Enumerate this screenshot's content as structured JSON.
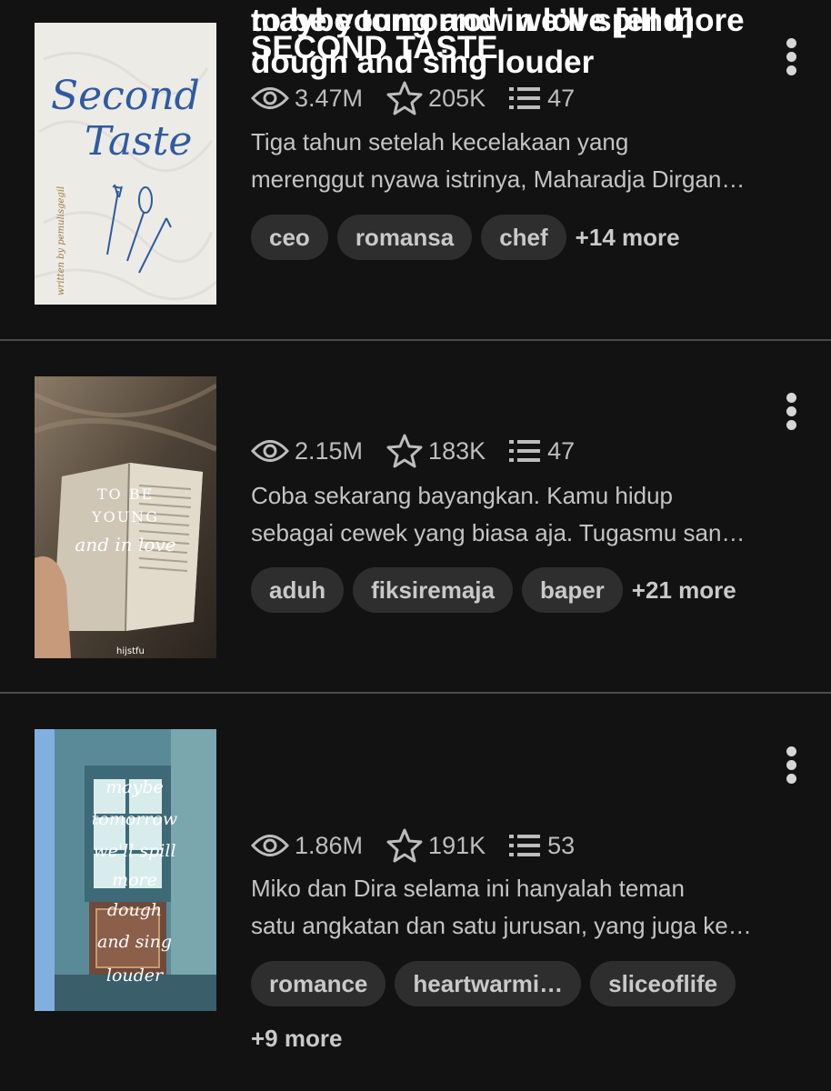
{
  "stories": [
    {
      "title": "SECOND TASTE",
      "views": "3.47M",
      "votes": "205K",
      "parts": "47",
      "desc_line1": "Tiga tahun setelah kecelakaan yang",
      "desc_line2": "merenggut nyawa istrinya, Maharadja Dirgan…",
      "tags": [
        "ceo",
        "romansa",
        "chef"
      ],
      "more": "+14 more",
      "cover_text": [
        "Second",
        "Taste",
        "written by pemulisgegil"
      ]
    },
    {
      "title": "to be young and in love [end]",
      "views": "2.15M",
      "votes": "183K",
      "parts": "47",
      "desc_line1": "Coba sekarang bayangkan. Kamu hidup",
      "desc_line2": "sebagai cewek yang biasa aja. Tugasmu san…",
      "tags": [
        "aduh",
        "fiksiremaja",
        "baper"
      ],
      "more": "+21 more",
      "cover_text": [
        "TO BE",
        "YOUNG",
        "and in love",
        "hijstfu"
      ]
    },
    {
      "title_line1": "maybe tomorrow we’ll spill more",
      "title_line2": "dough and sing louder",
      "views": "1.86M",
      "votes": "191K",
      "parts": "53",
      "desc_line1": "Miko dan Dira selama ini hanyalah teman",
      "desc_line2": "satu angkatan dan satu jurusan, yang juga ke…",
      "tags": [
        "romance",
        "heartwarmi…",
        "sliceoflife"
      ],
      "more": "+9 more",
      "cover_text": [
        "maybe",
        "tomorrow",
        "we'll spill",
        "more",
        "dough",
        "and sing",
        "louder"
      ]
    }
  ],
  "icons": {
    "views": "eye-icon",
    "votes": "star-icon",
    "parts": "list-icon",
    "menu": "more-vertical-icon"
  },
  "colors": {
    "background": "#121212",
    "tag_bg": "#2e2e2e",
    "text_secondary": "#c4c4c4",
    "divider": "#4a4a4a"
  }
}
